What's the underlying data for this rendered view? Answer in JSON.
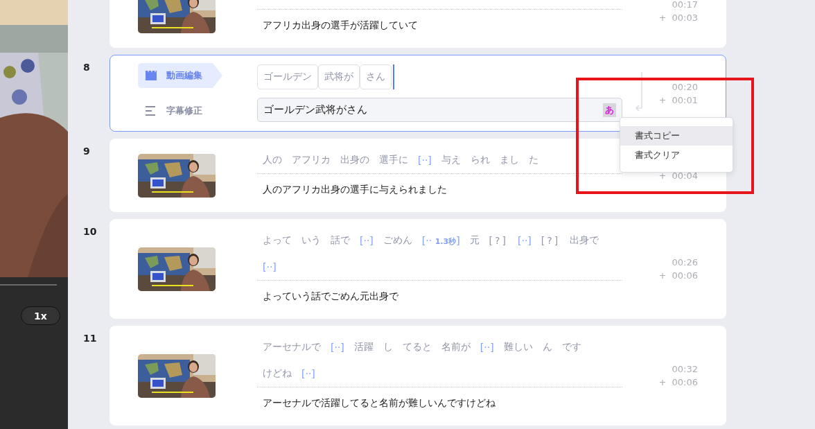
{
  "player": {
    "speed": "1x"
  },
  "segments": [
    {
      "kind": "clip",
      "sentence": "アフリカ出身の選手が活躍していて",
      "start": "00:17",
      "duration": "+  00:03"
    },
    {
      "kind": "editing",
      "number": "8",
      "modes": [
        {
          "kind": "video",
          "label": "動画編集",
          "selected": true
        },
        {
          "kind": "subtitle",
          "label": "字幕修正",
          "selected": false
        }
      ],
      "chips": [
        "ゴールデン",
        "武将が",
        "さん"
      ],
      "input": "ゴールデン武将がさん",
      "ime": "あ",
      "start": "00:20",
      "duration": "+  00:01",
      "menu": [
        {
          "label": "書式コピー",
          "selected": true
        },
        {
          "label": "書式クリア",
          "selected": false
        }
      ]
    },
    {
      "kind": "clip",
      "number": "9",
      "lines": [
        [
          {
            "kind": "word",
            "text": "人の"
          },
          {
            "kind": "word",
            "text": "アフリカ"
          },
          {
            "kind": "word",
            "text": "出身の"
          },
          {
            "kind": "word",
            "text": "選手に"
          },
          {
            "kind": "gap",
            "text": "[··]"
          },
          {
            "kind": "word",
            "text": "与え"
          },
          {
            "kind": "word",
            "text": "られ"
          },
          {
            "kind": "word",
            "text": "まし"
          },
          {
            "kind": "word",
            "text": "た"
          }
        ]
      ],
      "sentence": "人のアフリカ出身の選手に与えられました",
      "duration": "+  00:04"
    },
    {
      "kind": "clip",
      "number": "10",
      "lines": [
        [
          {
            "kind": "word",
            "text": "よって"
          },
          {
            "kind": "word",
            "text": "いう"
          },
          {
            "kind": "word",
            "text": "話で"
          },
          {
            "kind": "gap",
            "text": "[··]"
          },
          {
            "kind": "word",
            "text": "ごめん"
          },
          {
            "kind": "gap",
            "text": "[··",
            "length": "1.3秒",
            "end": "]"
          },
          {
            "kind": "word",
            "text": "元"
          },
          {
            "kind": "unknown",
            "text": "[?]"
          },
          {
            "kind": "gap",
            "text": "[··]"
          },
          {
            "kind": "unknown",
            "text": "[?]"
          },
          {
            "kind": "word",
            "text": "出身で"
          }
        ],
        [
          {
            "kind": "gap",
            "text": "[··]"
          }
        ]
      ],
      "sentence": "よっていう話でごめん元出身で",
      "start": "00:26",
      "duration": "+  00:06"
    },
    {
      "kind": "clip",
      "number": "11",
      "lines": [
        [
          {
            "kind": "word",
            "text": "アーセナルで"
          },
          {
            "kind": "gap",
            "text": "[··]"
          },
          {
            "kind": "word",
            "text": "活躍"
          },
          {
            "kind": "word",
            "text": "し"
          },
          {
            "kind": "word",
            "text": "てると"
          },
          {
            "kind": "word",
            "text": "名前が"
          },
          {
            "kind": "gap",
            "text": "[··]"
          },
          {
            "kind": "word",
            "text": "難しい"
          },
          {
            "kind": "word",
            "text": "ん"
          },
          {
            "kind": "word",
            "text": "です"
          }
        ],
        [
          {
            "kind": "word",
            "text": "けどね"
          },
          {
            "kind": "gap",
            "text": "[··]"
          }
        ]
      ],
      "sentence": "アーセナルで活躍してると名前が難しいんですけどね",
      "start": "00:32",
      "duration": "+  00:06"
    }
  ]
}
